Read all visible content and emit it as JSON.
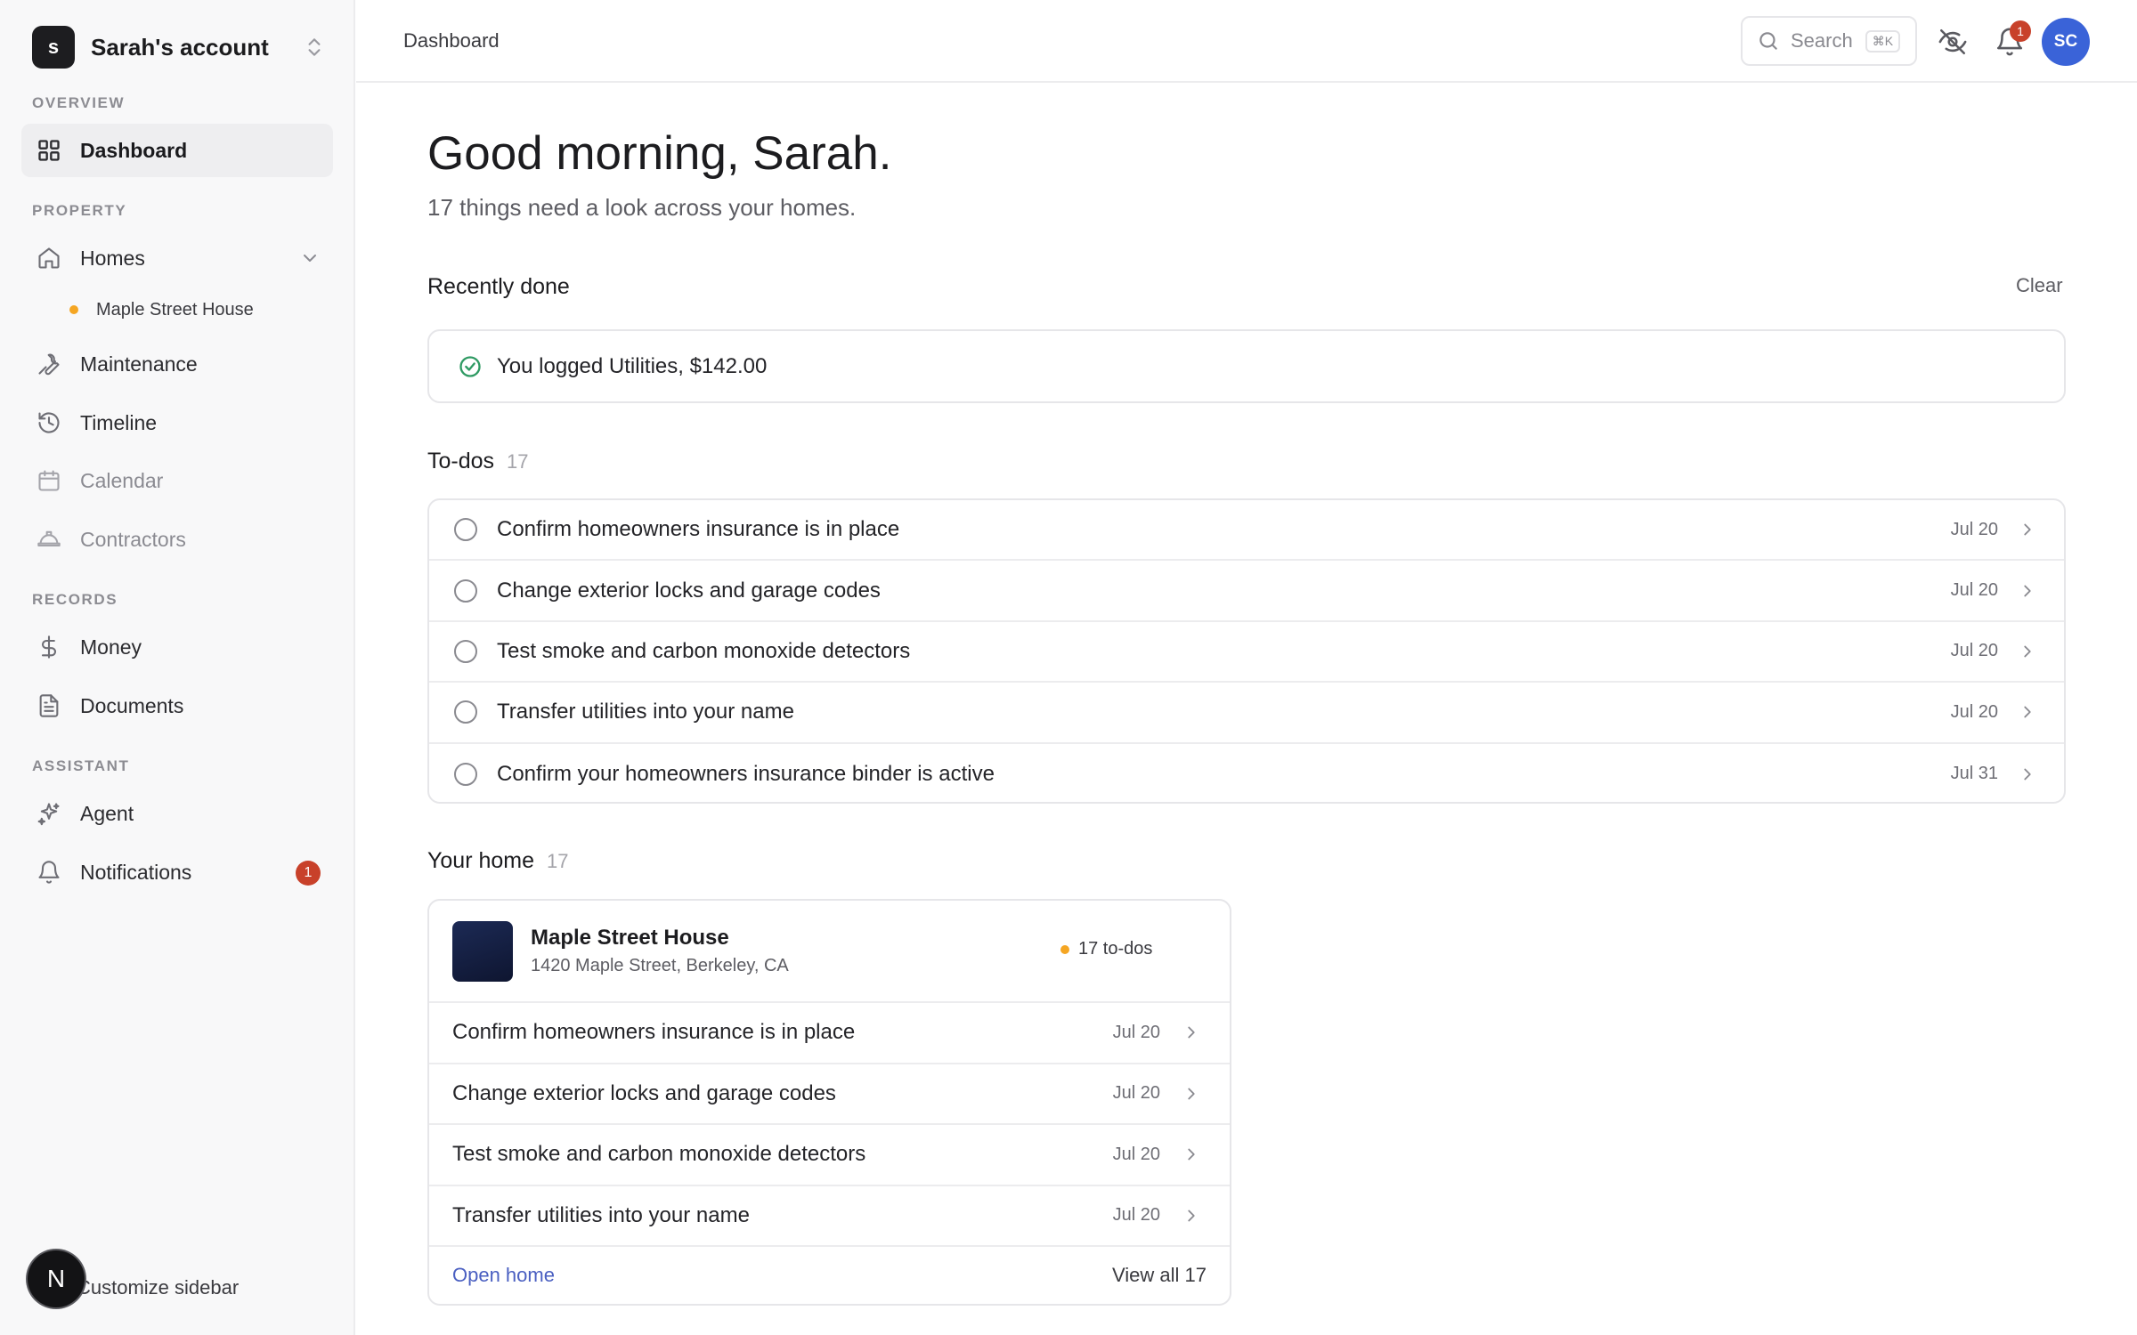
{
  "sidebar": {
    "account_initial": "s",
    "account_name": "Sarah's account",
    "sections": {
      "overview": "OVERVIEW",
      "property": "PROPERTY",
      "records": "RECORDS",
      "assistant": "ASSISTANT"
    },
    "items": {
      "dashboard": "Dashboard",
      "homes": "Homes",
      "home_sub": "Maple Street House",
      "maintenance": "Maintenance",
      "timeline": "Timeline",
      "calendar": "Calendar",
      "contractors": "Contractors",
      "money": "Money",
      "documents": "Documents",
      "agent": "Agent",
      "notifications": "Notifications",
      "notifications_count": "1"
    },
    "customize": "Customize sidebar",
    "fab_letter": "N"
  },
  "header": {
    "breadcrumb": "Dashboard",
    "search_placeholder": "Search",
    "search_shortcut": "⌘K",
    "bell_count": "1",
    "avatar_initials": "SC"
  },
  "main": {
    "greeting": "Good morning, Sarah.",
    "subtitle": "17 things need a look across your homes.",
    "recently_done": {
      "title": "Recently done",
      "clear": "Clear",
      "item": "You logged Utilities, $142.00"
    },
    "todos": {
      "title": "To-dos",
      "count": "17",
      "rows": [
        {
          "text": "Confirm homeowners insurance is in place",
          "date": "Jul 20"
        },
        {
          "text": "Change exterior locks and garage codes",
          "date": "Jul 20"
        },
        {
          "text": "Test smoke and carbon monoxide detectors",
          "date": "Jul 20"
        },
        {
          "text": "Transfer utilities into your name",
          "date": "Jul 20"
        },
        {
          "text": "Confirm your homeowners insurance binder is active",
          "date": "Jul 31"
        }
      ]
    },
    "your_home": {
      "title": "Your home",
      "count": "17",
      "name": "Maple Street House",
      "address": "1420 Maple Street, Berkeley, CA",
      "todos_badge": "17 to-dos",
      "rows": [
        {
          "text": "Confirm homeowners insurance is in place",
          "date": "Jul 20"
        },
        {
          "text": "Change exterior locks and garage codes",
          "date": "Jul 20"
        },
        {
          "text": "Test smoke and carbon monoxide detectors",
          "date": "Jul 20"
        },
        {
          "text": "Transfer utilities into your name",
          "date": "Jul 20"
        }
      ],
      "open_home": "Open home",
      "view_all": "View all 17"
    }
  }
}
